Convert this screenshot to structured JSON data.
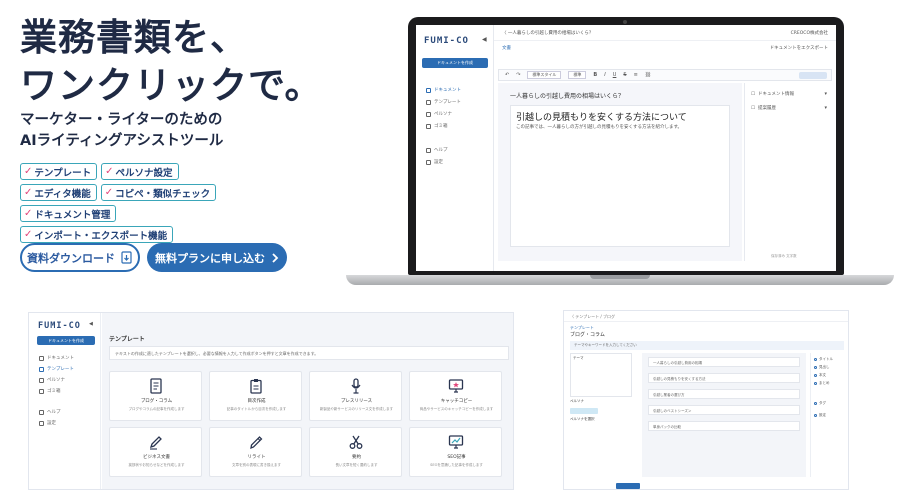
{
  "hero": {
    "title_line1": "業務書類を、",
    "title_line2": "ワンクリックで。",
    "subtitle_line1": "マーケター・ライターのための",
    "subtitle_line2": "AIライティングアシストツール",
    "features": [
      "テンプレート",
      "ペルソナ設定",
      "エディタ機能",
      "コピペ・類似チェック",
      "ドキュメント管理",
      "インポート・エクスポート機能"
    ],
    "cta_download": "資料ダウンロード",
    "cta_free": "無料プランに申し込む"
  },
  "app": {
    "logo": "FUMI-CO",
    "new_doc": "ドキュメントを作成",
    "nav": [
      "ドキュメント",
      "テンプレート",
      "ペルソナ",
      "ゴミ箱"
    ],
    "nav_bottom": [
      "ヘルプ",
      "設定"
    ],
    "breadcrumb": "〈 一人暮らしの引越し費用の相場はいくら？",
    "company": "CREOCO株式会社",
    "doc_label": "文書",
    "export": "ドキュメントをエクスポート",
    "toolbar_style": "標準スタイル",
    "toolbar_size": "標準",
    "editor_heading": "一人暮らしの引越し費用の相場はいくら？",
    "editor_h2": "引越しの見積もりを安くする方法について",
    "editor_body": "この記事では、一人暮らしの方が引越しの見積もりを安くする方法を紹介します。",
    "right_panel": [
      "ドキュメント情報",
      "提案履歴"
    ],
    "footer": "保存済み  文字数"
  },
  "templates": {
    "logo": "FUMI-CO",
    "new_doc": "ドキュメントを作成",
    "nav": [
      "ドキュメント",
      "テンプレート",
      "ペルソナ",
      "ゴミ箱"
    ],
    "nav_bottom": [
      "ヘルプ",
      "設定"
    ],
    "title": "テンプレート",
    "info": "テキストの作成に適したテンプレートを選択し、必要な情報を入力して作成ボタンを押すと文章を作成できます。",
    "cards": [
      {
        "name": "ブログ・コラム",
        "desc": "ブログやコラムの記事を作成します"
      },
      {
        "name": "目次作成",
        "desc": "記事のタイトルから目次を作成します"
      },
      {
        "name": "プレスリリース",
        "desc": "新製品や新サービスのリリース文を作成します"
      },
      {
        "name": "キャッチコピー",
        "desc": "商品やサービスのキャッチコピーを作成します"
      },
      {
        "name": "ビジネス文書",
        "desc": "挨拶状やお知らせなどを作成します"
      },
      {
        "name": "リライト",
        "desc": "文章を別の表現に書き換えます"
      },
      {
        "name": "要約",
        "desc": "長い文章を短く要約します"
      },
      {
        "name": "SEO記事",
        "desc": "SEOを意識した記事を作成します"
      }
    ]
  },
  "persona": {
    "header": "〈 テンプレート / ブログ",
    "sub": "テンプレート",
    "title": "ブログ・コラム",
    "info": "テーマやキーワードを入力してください",
    "left_box": "テーマ",
    "left_mini": "ペルソナ",
    "left_mini2": "ペルソナを選択",
    "rows": [
      "一人暮らしの引越し費用の相場",
      "引越しの見積もりを安くする方法",
      "引越し業者の選び方",
      "引越しのベストシーズン",
      "単身パックの比較"
    ],
    "right": [
      "タイトル",
      "見出し",
      "本文",
      "まとめ",
      "タグ",
      "設定"
    ]
  }
}
